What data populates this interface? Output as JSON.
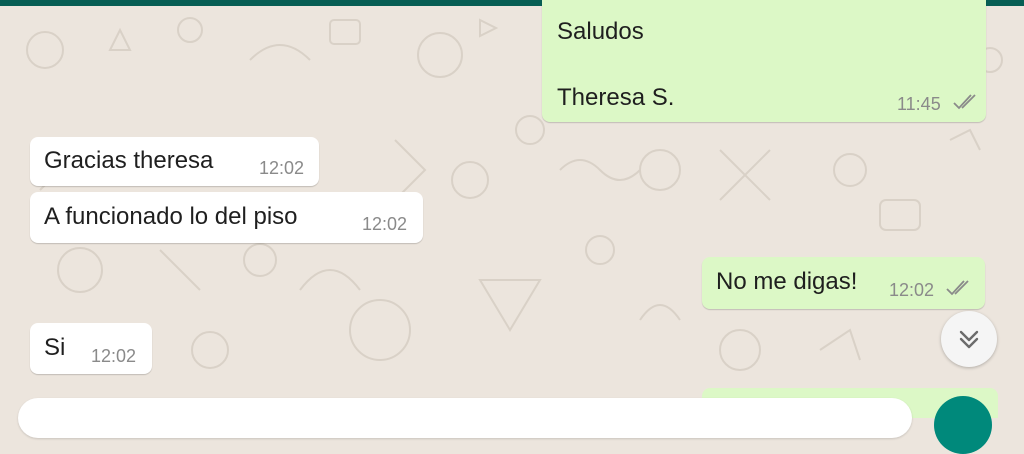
{
  "conversation": {
    "messages": [
      {
        "direction": "out",
        "lines": [
          "Saludos",
          "Theresa S."
        ],
        "time": "11:45",
        "status": "read"
      },
      {
        "direction": "in",
        "text": "Gracias theresa",
        "time": "12:02"
      },
      {
        "direction": "in",
        "text": "A funcionado lo del piso",
        "time": "12:02"
      },
      {
        "direction": "out",
        "text": "No me digas!",
        "time": "12:02",
        "status": "read"
      },
      {
        "direction": "in",
        "text": "Si",
        "time": "12:02"
      }
    ]
  },
  "colors": {
    "wallpaper": "#ece5dd",
    "incoming_bubble": "#ffffff",
    "outgoing_bubble": "#dcf8c6",
    "header": "#075e54",
    "send_button": "#00897b",
    "ticks": "#8a8a8a"
  },
  "icons": {
    "scroll_down": "chevron-double-down-icon",
    "read_receipt": "double-check-icon"
  }
}
